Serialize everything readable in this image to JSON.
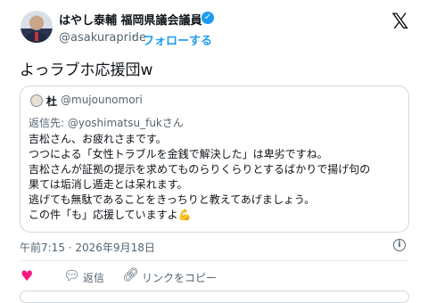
{
  "author": {
    "name": "はやし泰輔 福岡県議会議員",
    "handle": "@asakurapride",
    "follow_label": "フォローする",
    "separator": "·"
  },
  "tweet": {
    "text": "よっラブホ応援団w",
    "timestamp": "午前7:15 · 2026年9月18日"
  },
  "quoted": {
    "name": "杜",
    "handle": "@mujounomori",
    "reply_to_label": "返信先: ",
    "reply_to_handle": "@yoshimatsu_fukさん",
    "lines": [
      "吉松さん、お疲れさまです。",
      "つつによる「女性トラブルを金銭で解決した」は卑劣ですね。",
      "吉松さんが証拠の提示を求めてものらりくらりとするばかりで揚げ句の",
      "果ては垢消し遁走とは呆れます。",
      "逃げても無駄であることをきっちりと教えてあげましょう。",
      "この件「も」応援していますよ"
    ],
    "last_emoji": "💪"
  },
  "actions": {
    "reply_label": "返信",
    "copy_link_label": "リンクをコピー"
  },
  "icons": {
    "verified": "verified-badge-icon",
    "x_logo": "x-logo-icon",
    "info": "info-icon",
    "heart": "heart-icon",
    "comment": "comment-icon",
    "link": "link-icon"
  },
  "colors": {
    "accent": "#1d9bf0",
    "heart": "#f91880",
    "muted": "#536471"
  }
}
